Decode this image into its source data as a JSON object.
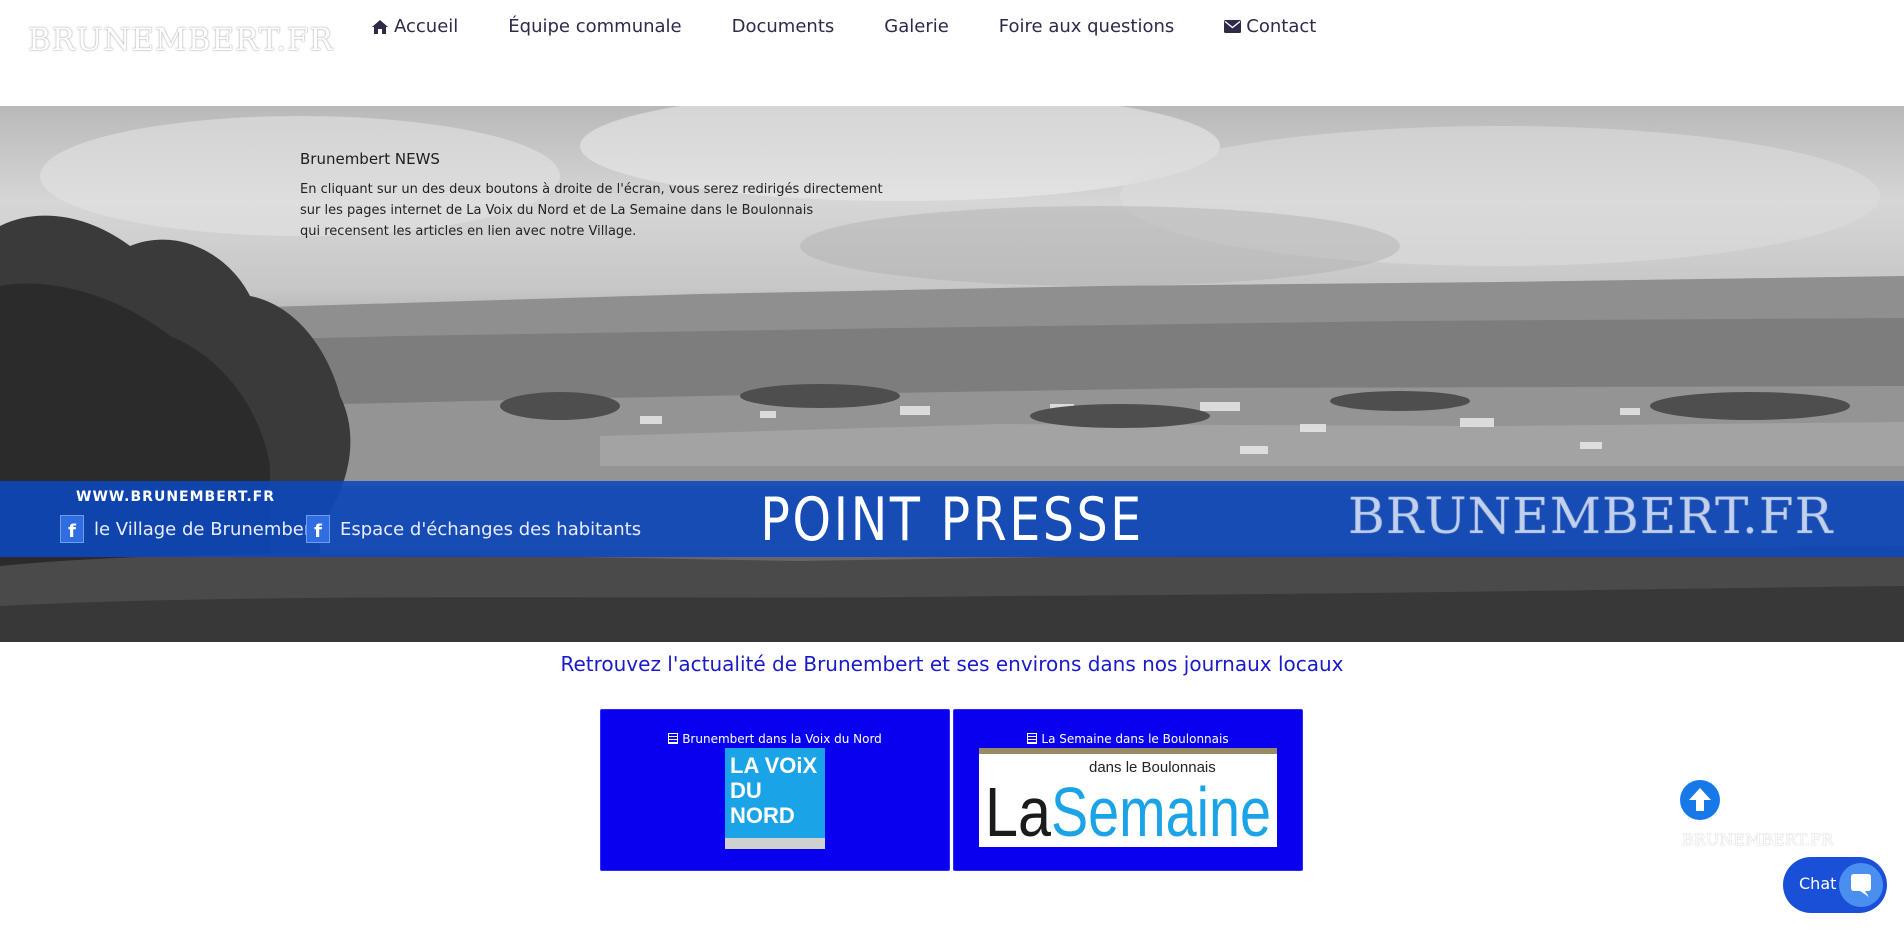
{
  "header": {
    "logo": "BRUNEMBERT.FR",
    "nav": [
      {
        "label": "Accueil",
        "icon": "home-icon"
      },
      {
        "label": "Équipe communale"
      },
      {
        "label": "Documents"
      },
      {
        "label": "Galerie"
      },
      {
        "label": "Foire aux questions"
      },
      {
        "label": "Contact",
        "icon": "envelope-icon"
      }
    ]
  },
  "hero": {
    "news_title": "Brunembert NEWS",
    "news_lines": [
      "En cliquant sur un des deux boutons à droite de l'écran, vous serez redirigés directement",
      "sur les pages internet de La Voix du Nord et de La Semaine dans le Boulonnais",
      "qui recensent les articles en lien avec notre Village."
    ],
    "band": {
      "url": "WWW.BRUNEMBERT.FR",
      "facebook_links": [
        "le Village de Brunembert",
        "Espace d'échanges des habitants"
      ],
      "title": "POINT PRESSE",
      "watermark": "BRUNEMBERT.FR"
    }
  },
  "content": {
    "headline": "Retrouvez l'actualité de Brunembert et ses environs dans nos journaux locaux",
    "cards": [
      {
        "label": "Brunembert dans la Voix du Nord",
        "logo_text": [
          "LA VOiX",
          "DU",
          "NORD"
        ]
      },
      {
        "label": "La Semaine dans le Boulonnais",
        "logo_small": "dans le Boulonnais",
        "logo_la": "La",
        "logo_main": "Semaine"
      }
    ]
  },
  "floating": {
    "small_logo": "BRUNEMBERT.FR",
    "chat_label": "Chat"
  },
  "colors": {
    "band": "#0a48be",
    "card": "#0a00f0",
    "headline": "#1a1acb",
    "scroll_button": "#1778e8",
    "chat": "#1a4fd8"
  }
}
